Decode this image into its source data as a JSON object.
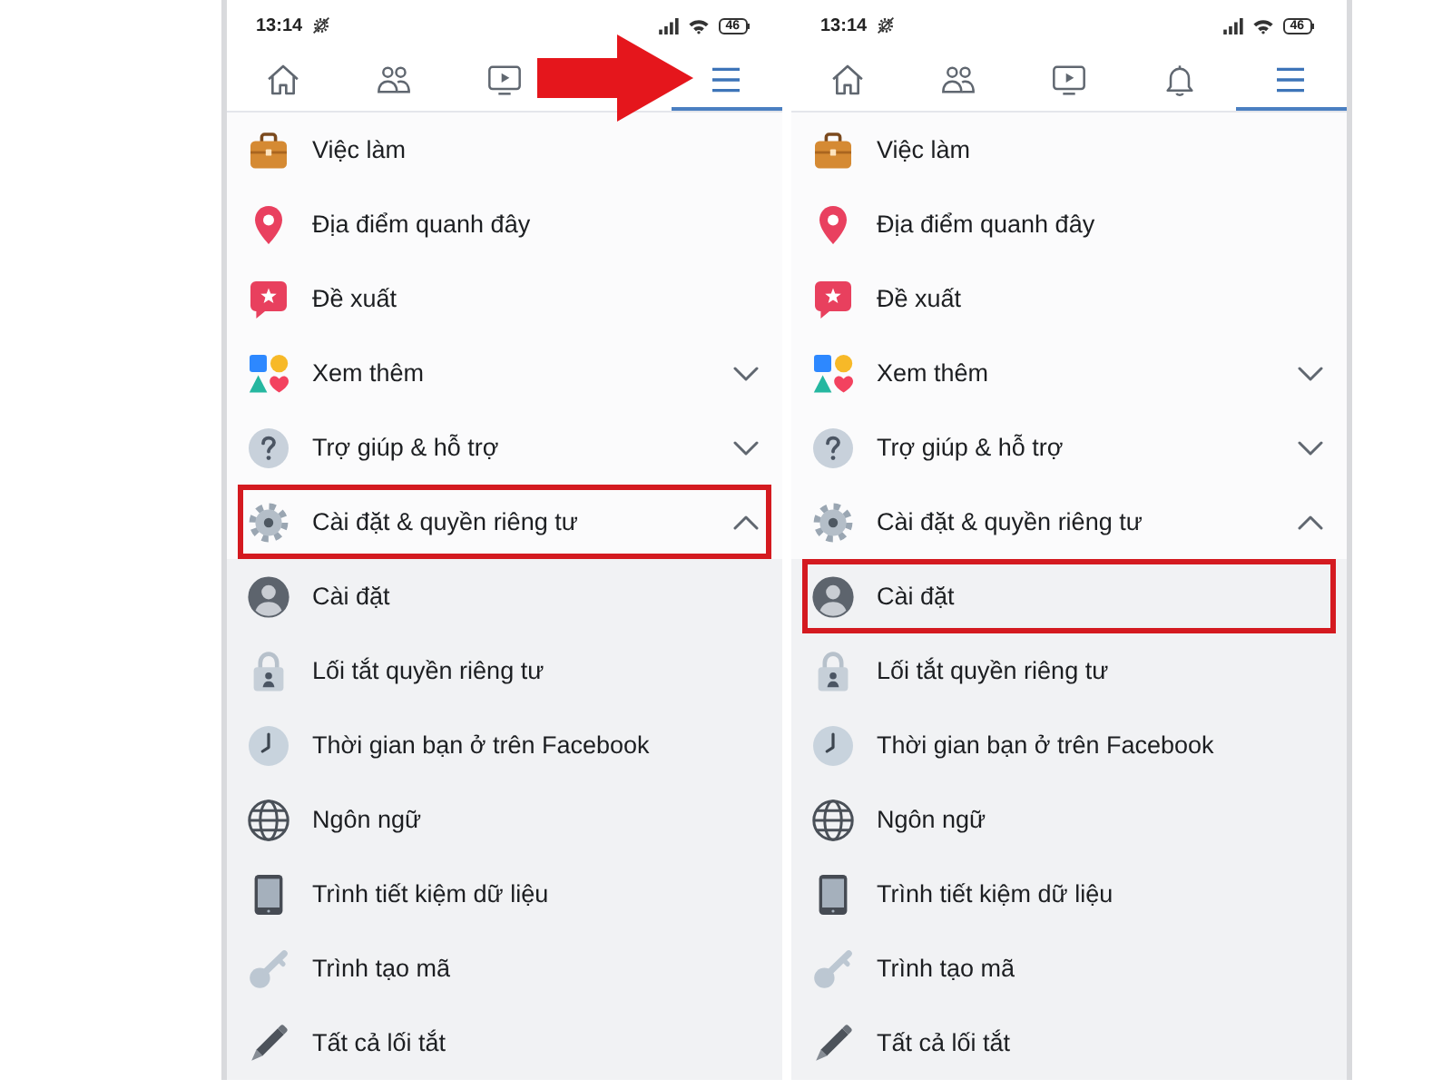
{
  "panels": [
    {
      "status_bar": {
        "time": "13:14",
        "battery": "46"
      },
      "arrow": true,
      "nav_tabs": [
        {
          "kind": "home",
          "selected": false
        },
        {
          "kind": "friends",
          "selected": false
        },
        {
          "kind": "video",
          "selected": false
        },
        {
          "kind": "menu",
          "selected": true
        }
      ],
      "menu": [
        {
          "kind": "briefcase",
          "label": "Việc làm",
          "highlighted": false
        },
        {
          "kind": "pin",
          "label": "Địa điểm quanh đây",
          "highlighted": false
        },
        {
          "kind": "star",
          "label": "Đề xuất",
          "highlighted": false
        },
        {
          "kind": "shapes",
          "label": "Xem thêm",
          "expanded": false,
          "highlighted": false
        },
        {
          "kind": "help",
          "label": "Trợ giúp & hỗ trợ",
          "expanded": false,
          "highlighted": false
        },
        {
          "kind": "gear",
          "label": "Cài đặt & quyền riêng tư",
          "expanded": true,
          "highlighted": true,
          "children": [
            {
              "kind": "account",
              "label": "Cài đặt",
              "highlighted": false
            },
            {
              "kind": "lock",
              "label": "Lối tắt quyền riêng tư",
              "highlighted": false
            },
            {
              "kind": "clock",
              "label": "Thời gian bạn ở trên Facebook",
              "highlighted": false
            },
            {
              "kind": "globe",
              "label": "Ngôn ngữ",
              "highlighted": false
            },
            {
              "kind": "tablet",
              "label": "Trình tiết kiệm dữ liệu",
              "highlighted": false
            },
            {
              "kind": "key",
              "label": "Trình tạo mã",
              "highlighted": false
            },
            {
              "kind": "pencil",
              "label": "Tất cả lối tắt",
              "highlighted": false
            }
          ]
        }
      ]
    },
    {
      "status_bar": {
        "time": "13:14",
        "battery": "46"
      },
      "nav_tabs": [
        {
          "kind": "home",
          "selected": false
        },
        {
          "kind": "friends",
          "selected": false
        },
        {
          "kind": "video",
          "selected": false
        },
        {
          "kind": "bell",
          "selected": false
        },
        {
          "kind": "menu",
          "selected": true
        }
      ],
      "menu": [
        {
          "kind": "briefcase",
          "label": "Việc làm",
          "highlighted": false
        },
        {
          "kind": "pin",
          "label": "Địa điểm quanh đây",
          "highlighted": false
        },
        {
          "kind": "star",
          "label": "Đề xuất",
          "highlighted": false
        },
        {
          "kind": "shapes",
          "label": "Xem thêm",
          "expanded": false,
          "highlighted": false
        },
        {
          "kind": "help",
          "label": "Trợ giúp & hỗ trợ",
          "expanded": false,
          "highlighted": false
        },
        {
          "kind": "gear",
          "label": "Cài đặt & quyền riêng tư",
          "expanded": true,
          "highlighted": false,
          "children": [
            {
              "kind": "account",
              "label": "Cài đặt",
              "highlighted": true
            },
            {
              "kind": "lock",
              "label": "Lối tắt quyền riêng tư",
              "highlighted": false
            },
            {
              "kind": "clock",
              "label": "Thời gian bạn ở trên Facebook",
              "highlighted": false
            },
            {
              "kind": "globe",
              "label": "Ngôn ngữ",
              "highlighted": false
            },
            {
              "kind": "tablet",
              "label": "Trình tiết kiệm dữ liệu",
              "highlighted": false
            },
            {
              "kind": "key",
              "label": "Trình tạo mã",
              "highlighted": false
            },
            {
              "kind": "pencil",
              "label": "Tất cả lối tắt",
              "highlighted": false
            }
          ]
        }
      ]
    }
  ]
}
